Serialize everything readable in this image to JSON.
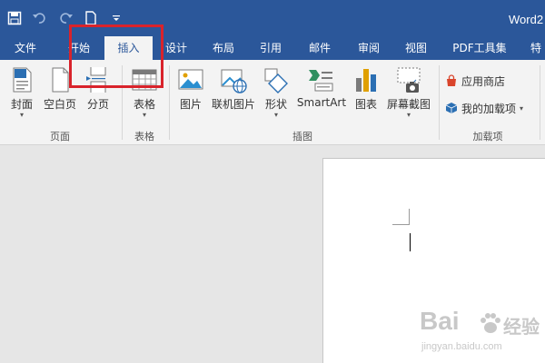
{
  "window": {
    "title": "Word2"
  },
  "quick_access": {
    "icons": [
      "save-icon",
      "undo-icon",
      "redo-icon",
      "new-document-icon",
      "customize-arrow-icon"
    ]
  },
  "tabs": [
    {
      "label": "文件"
    },
    {
      "label": "开始"
    },
    {
      "label": "插入",
      "active": true
    },
    {
      "label": "设计"
    },
    {
      "label": "布局"
    },
    {
      "label": "引用"
    },
    {
      "label": "邮件"
    },
    {
      "label": "审阅"
    },
    {
      "label": "视图"
    },
    {
      "label": "PDF工具集"
    },
    {
      "label": "特"
    }
  ],
  "ribbon": {
    "groups": {
      "pages": {
        "label": "页面",
        "buttons": {
          "cover": "封面",
          "blank": "空白页",
          "break": "分页"
        }
      },
      "tables": {
        "label": "表格",
        "buttons": {
          "table": "表格"
        }
      },
      "illustrations": {
        "label": "插图",
        "buttons": {
          "pictures": "图片",
          "online": "联机图片",
          "shapes": "形状",
          "smartart": "SmartArt",
          "chart": "图表",
          "screenshot": "屏幕截图"
        }
      },
      "addins": {
        "label": "加载项",
        "buttons": {
          "store": "应用商店",
          "my": "我的加载项"
        }
      }
    },
    "dropdown_glyph": "▾"
  },
  "colors": {
    "brand": "#2b579a",
    "highlight": "#d9232b"
  },
  "watermark": {
    "brand": "Bai",
    "cn": "经验",
    "url": "jingyan.baidu.com"
  }
}
